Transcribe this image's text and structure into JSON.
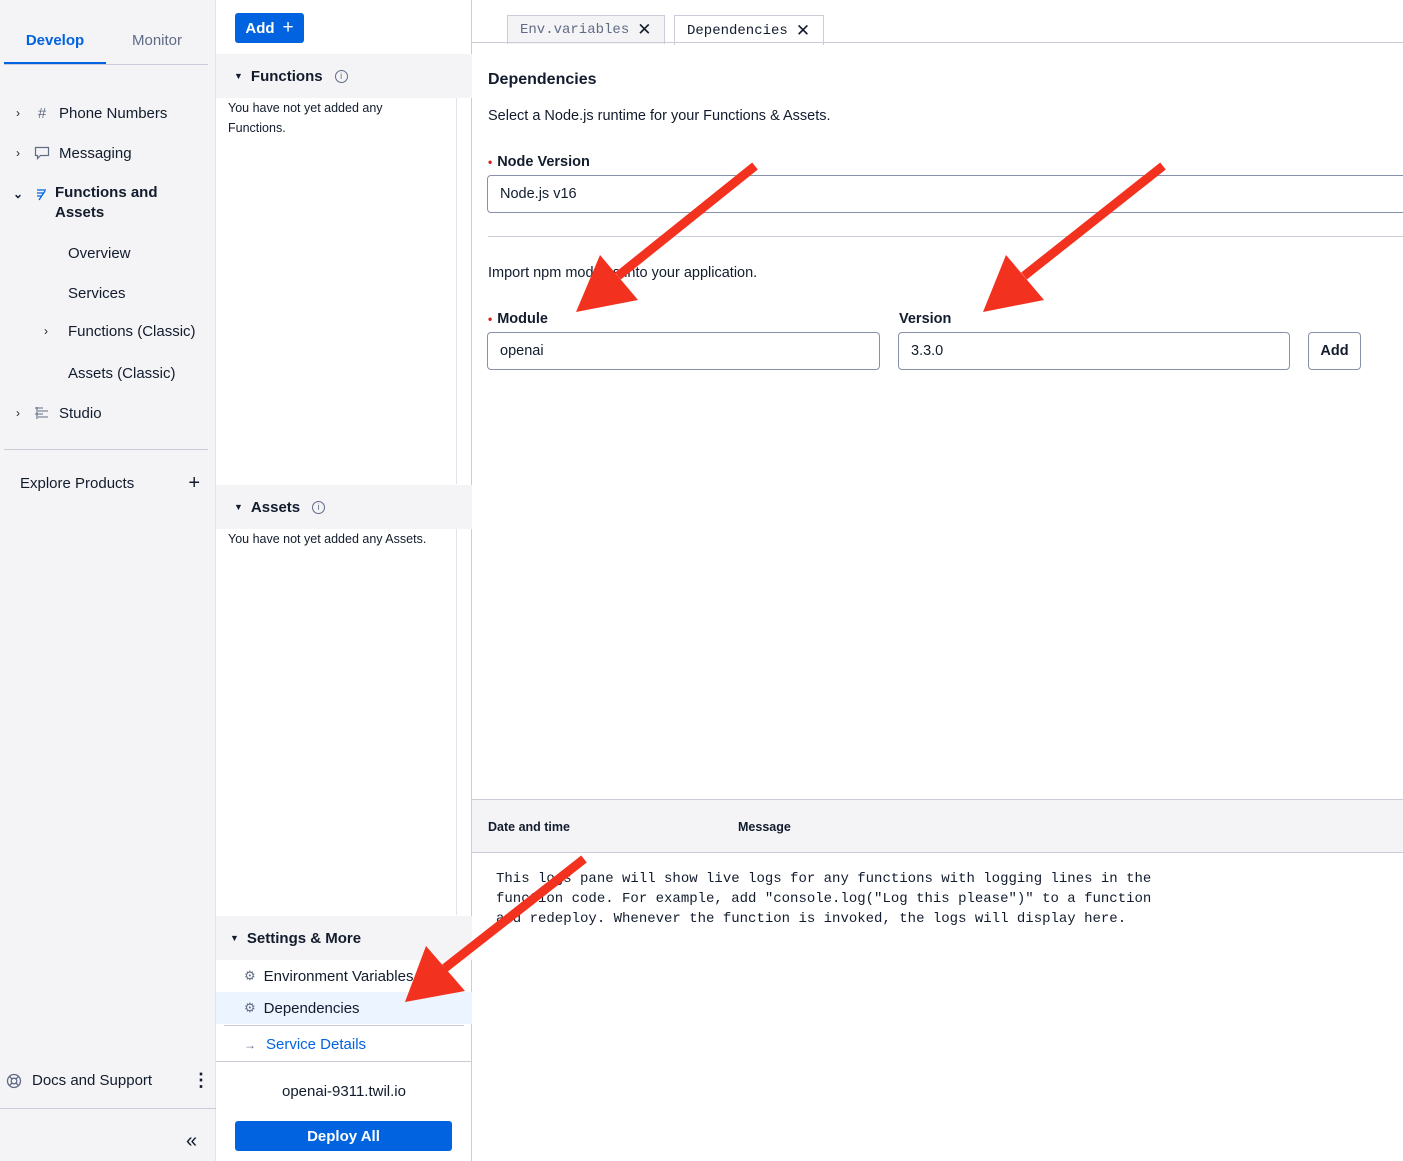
{
  "nav": {
    "tabs": [
      {
        "label": "Develop"
      },
      {
        "label": "Monitor"
      }
    ],
    "items": [
      {
        "label": "Phone Numbers",
        "icon": "hash-icon"
      },
      {
        "label": "Messaging",
        "icon": "chat-icon"
      },
      {
        "label": "Functions and Assets",
        "icon": "functions-icon"
      },
      {
        "label": "Studio",
        "icon": "studio-icon"
      }
    ],
    "sub_items": [
      {
        "label": "Overview"
      },
      {
        "label": "Services"
      },
      {
        "label": "Functions (Classic)"
      },
      {
        "label": "Assets (Classic)"
      }
    ],
    "explore": "Explore Products",
    "docs": "Docs and Support"
  },
  "middle": {
    "add_label": "Add",
    "functions": {
      "title": "Functions",
      "empty": "You have not yet added any Functions."
    },
    "assets": {
      "title": "Assets",
      "empty": "You have not yet added any Assets."
    },
    "settings": {
      "title": "Settings & More",
      "items": [
        {
          "label": "Environment Variables"
        },
        {
          "label": "Dependencies"
        }
      ],
      "service_details": "Service Details"
    },
    "domain": "openai-9311.twil.io",
    "deploy_label": "Deploy All"
  },
  "editor": {
    "tabs": [
      {
        "label": "Env.variables"
      },
      {
        "label": "Dependencies"
      }
    ],
    "title": "Dependencies",
    "subtitle": "Select a Node.js runtime for your Functions & Assets.",
    "node_version_label": "Node Version",
    "node_version_value": "Node.js v16",
    "import_text": "Import npm modules into your application.",
    "module_label": "Module",
    "module_value": "openai",
    "version_label": "Version",
    "version_value": "3.3.0",
    "add_label": "Add"
  },
  "logs": {
    "col_date": "Date and time",
    "col_message": "Message",
    "body": "This logs pane will show live logs for any functions with logging lines in the\nfunction code. For example, add \"console.log(\"Log this please\")\" to a function\nand redeploy. Whenever the function is invoked, the logs will display here."
  },
  "colors": {
    "accent": "#0263e0",
    "arrow": "#f2311f",
    "required": "#d61f1f"
  }
}
